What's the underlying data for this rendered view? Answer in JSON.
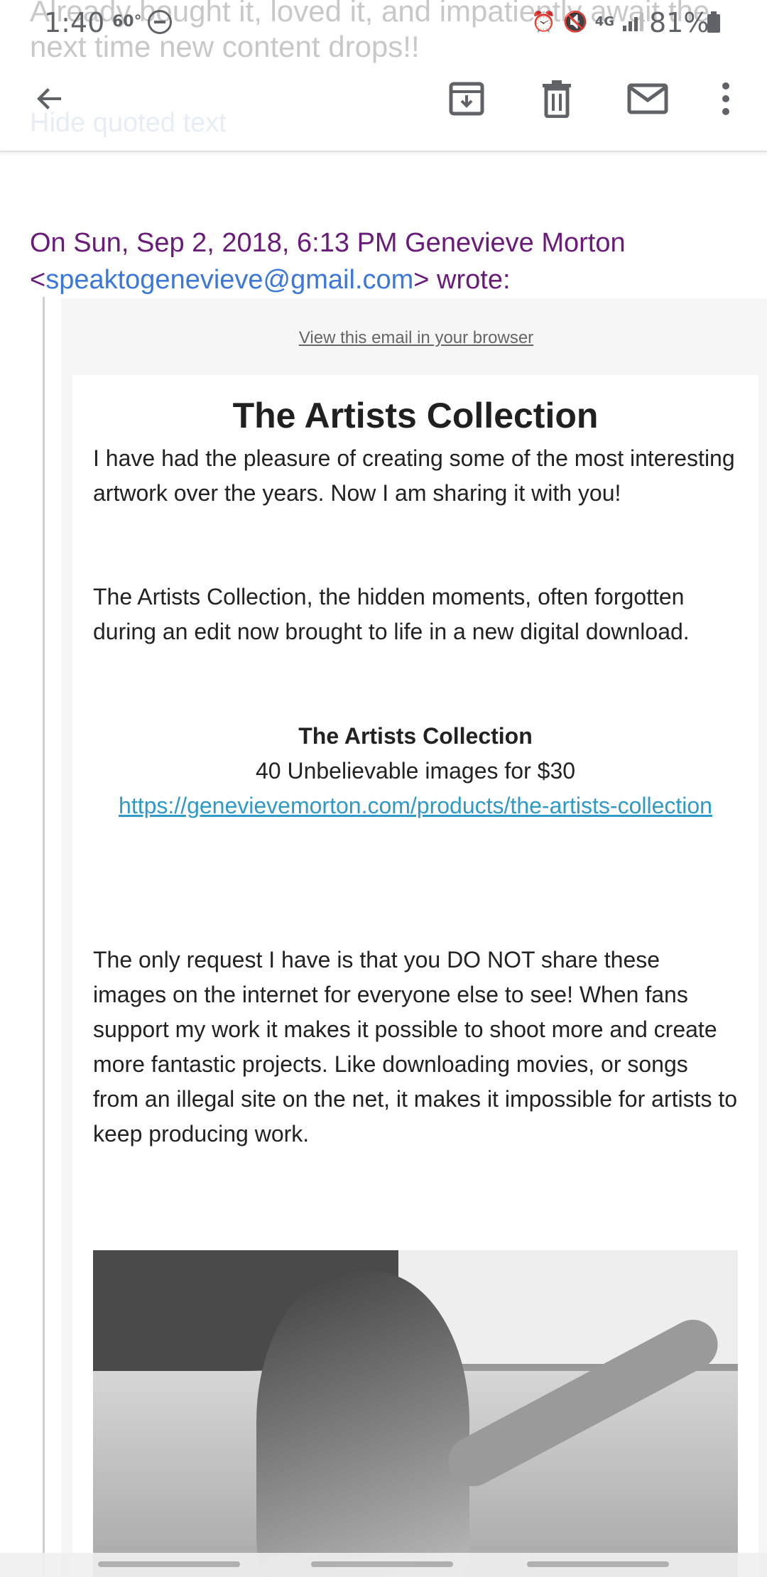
{
  "background_text": {
    "line1": "Already bought it, loved it, and impatiently await the",
    "line2": "next time new content drops!!",
    "hide_quoted": "Hide quoted text"
  },
  "status_bar": {
    "time": "1:40",
    "temperature": "60°",
    "battery": "81%",
    "icons": [
      "dnd-icon",
      "alarm-icon",
      "mute-icon",
      "data-4g-icon",
      "signal-icon",
      "battery-icon"
    ]
  },
  "app_bar": {
    "icons": [
      "back-arrow-icon",
      "archive-icon",
      "delete-icon",
      "mail-icon",
      "more-vert-icon"
    ]
  },
  "quote": {
    "prefix": "On Sun, Sep 2, 2018, 6:13 PM Genevieve Morton",
    "lt": "<",
    "email": "speaktogenevieve@gmail.com",
    "suffix": "> wrote:"
  },
  "email": {
    "view_in_browser": "View this email in your browser",
    "title": "The Artists Collection",
    "paragraph1": "I have had the pleasure of creating some of the most interesting artwork over the years. Now I am sharing it with you!",
    "paragraph2": "The Artists Collection, the hidden moments, often forgotten during an edit now brought to life in a new digital download.",
    "product_name": "The Artists Collection",
    "product_desc": "40 Unbelievable images for $30",
    "product_url": "https://genevievemorton.com/products/the-artists-collection",
    "paragraph3": "The only request I have is that you DO NOT share these images on the internet for everyone else to see! When fans support my work it makes it possible to shoot more and create more fantastic projects. Like downloading movies, or songs from an illegal site on the net, it makes it impossible for artists to keep producing work."
  },
  "colors": {
    "quote_header": "#6a1b7a",
    "link": "#3b78d8",
    "product_link": "#2e9ac7"
  }
}
